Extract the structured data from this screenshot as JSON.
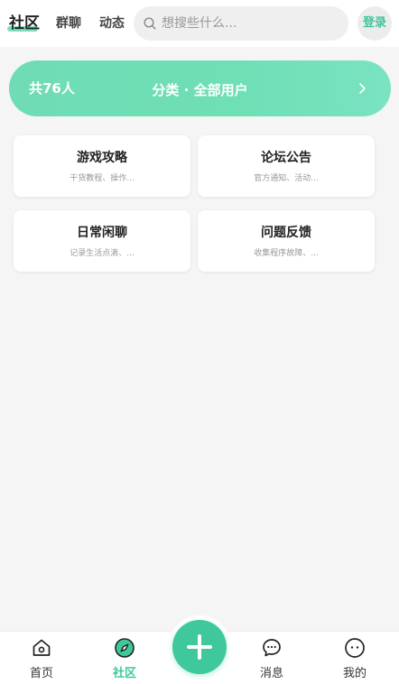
{
  "header": {
    "tabs": [
      {
        "label": "社区",
        "active": true
      },
      {
        "label": "群聊",
        "active": false
      },
      {
        "label": "动态",
        "active": false
      }
    ],
    "search": {
      "placeholder": "想搜些什么..."
    },
    "login_label": "登录"
  },
  "banner": {
    "count_text": "共76人",
    "title": "分类 · 全部用户"
  },
  "categories": [
    {
      "title": "游戏攻略",
      "desc": "干货教程、操作..."
    },
    {
      "title": "论坛公告",
      "desc": "官方通知、活动..."
    },
    {
      "title": "日常闲聊",
      "desc": "记录生活点滴、..."
    },
    {
      "title": "问题反馈",
      "desc": "收集程序故障、..."
    }
  ],
  "bottom_nav": {
    "items": [
      {
        "label": "首页",
        "icon": "home-icon",
        "active": false
      },
      {
        "label": "社区",
        "icon": "compass-icon",
        "active": true
      },
      {
        "label": "消息",
        "icon": "chat-bubble-icon",
        "active": false
      },
      {
        "label": "我的",
        "icon": "face-icon",
        "active": false
      }
    ],
    "fab_icon": "plus-icon"
  },
  "colors": {
    "accent": "#3ec89c",
    "banner": "#6fdcb5",
    "background": "#f5f5f5"
  }
}
